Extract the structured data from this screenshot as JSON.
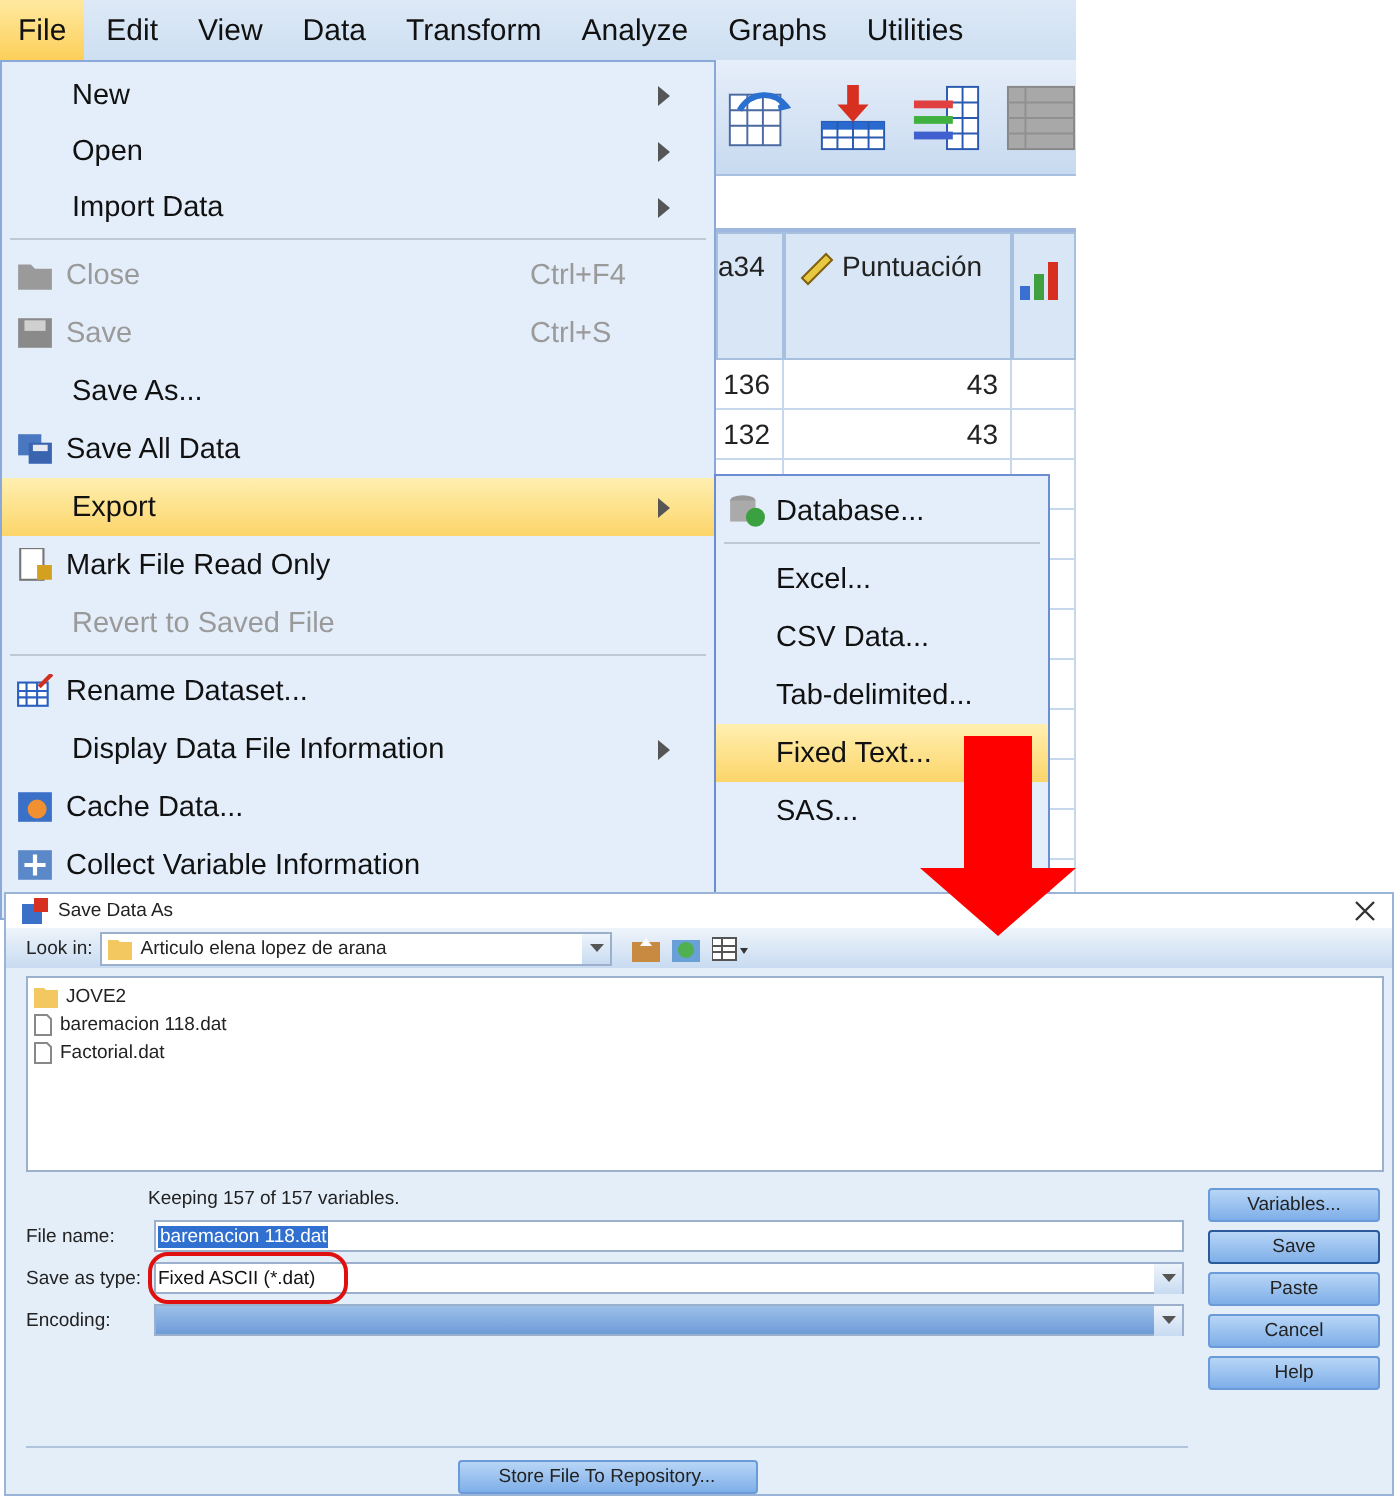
{
  "menu_bar": [
    {
      "label": "File",
      "selected": true
    },
    {
      "label": "Edit",
      "selected": false
    },
    {
      "label": "View",
      "selected": false
    },
    {
      "label": "Data",
      "selected": false
    },
    {
      "label": "Transform",
      "selected": false
    },
    {
      "label": "Analyze",
      "selected": false
    },
    {
      "label": "Graphs",
      "selected": false
    },
    {
      "label": "Utilities",
      "selected": false
    }
  ],
  "data_grid": {
    "columns": [
      {
        "label": "a34",
        "kind": "plain"
      },
      {
        "label": "Puntuación",
        "kind": "scale"
      },
      {
        "kind": "ordinal"
      }
    ],
    "rows": [
      [
        "136",
        "43"
      ],
      [
        "132",
        "43"
      ]
    ]
  },
  "file_menu": [
    {
      "kind": "item",
      "label": "New",
      "submenu": true,
      "disabled": false,
      "selected": false
    },
    {
      "kind": "item",
      "label": "Open",
      "submenu": true,
      "disabled": false,
      "selected": false
    },
    {
      "kind": "item",
      "label": "Import Data",
      "submenu": true,
      "disabled": false,
      "selected": false
    },
    {
      "kind": "separator"
    },
    {
      "kind": "item",
      "label": "Close",
      "shortcut": "Ctrl+F4",
      "submenu": false,
      "disabled": true,
      "selected": false
    },
    {
      "kind": "item",
      "label": "Save",
      "shortcut": "Ctrl+S",
      "submenu": false,
      "disabled": true,
      "selected": false
    },
    {
      "kind": "item",
      "label": "Save As...",
      "submenu": false,
      "disabled": false,
      "selected": false
    },
    {
      "kind": "item",
      "label": "Save All Data",
      "submenu": false,
      "disabled": false,
      "selected": false
    },
    {
      "kind": "item",
      "label": "Export",
      "submenu": true,
      "disabled": false,
      "selected": true
    },
    {
      "kind": "item",
      "label": "Mark File Read Only",
      "submenu": false,
      "disabled": false,
      "selected": false
    },
    {
      "kind": "item",
      "label": "Revert to Saved File",
      "submenu": false,
      "disabled": true,
      "selected": false
    },
    {
      "kind": "separator"
    },
    {
      "kind": "item",
      "label": "Rename Dataset...",
      "submenu": false,
      "disabled": false,
      "selected": false
    },
    {
      "kind": "item",
      "label": "Display Data File Information",
      "submenu": true,
      "disabled": false,
      "selected": false
    },
    {
      "kind": "item",
      "label": "Cache Data...",
      "submenu": false,
      "disabled": false,
      "selected": false
    },
    {
      "kind": "item",
      "label": "Collect Variable Information",
      "submenu": false,
      "disabled": false,
      "selected": false
    }
  ],
  "export_menu": [
    {
      "kind": "item",
      "label": "Database...",
      "selected": false
    },
    {
      "kind": "separator"
    },
    {
      "kind": "item",
      "label": "Excel...",
      "selected": false
    },
    {
      "kind": "item",
      "label": "CSV Data...",
      "selected": false
    },
    {
      "kind": "item",
      "label": "Tab-delimited...",
      "selected": false
    },
    {
      "kind": "item",
      "label": "Fixed Text...",
      "selected": true
    },
    {
      "kind": "item",
      "label": "SAS...",
      "selected": false
    }
  ],
  "dialog": {
    "title": "Save Data As",
    "look_in": {
      "label": "Look in:",
      "value": "Articulo elena lopez de arana"
    },
    "files": [
      {
        "name": "JOVE2",
        "kind": "folder"
      },
      {
        "name": "baremacion 118.dat",
        "kind": "file"
      },
      {
        "name": "Factorial.dat",
        "kind": "file"
      }
    ],
    "status": "Keeping 157 of 157 variables.",
    "fields": [
      {
        "label": "File name:",
        "value": "baremacion 118.dat",
        "kind": "text",
        "text_selected": true,
        "circled": false
      },
      {
        "label": "Save as type:",
        "value": "Fixed ASCII (*.dat)",
        "kind": "dropdown",
        "text_selected": false,
        "circled": true
      },
      {
        "label": "Encoding:",
        "kind": "dropdown",
        "circled": false
      }
    ],
    "buttons": [
      {
        "label": "Variables...",
        "default": false
      },
      {
        "label": "Save",
        "default": true
      },
      {
        "label": "Paste",
        "default": false
      },
      {
        "label": "Cancel",
        "default": false
      },
      {
        "label": "Help",
        "default": false
      }
    ],
    "repository_button": "Store File To Repository..."
  }
}
